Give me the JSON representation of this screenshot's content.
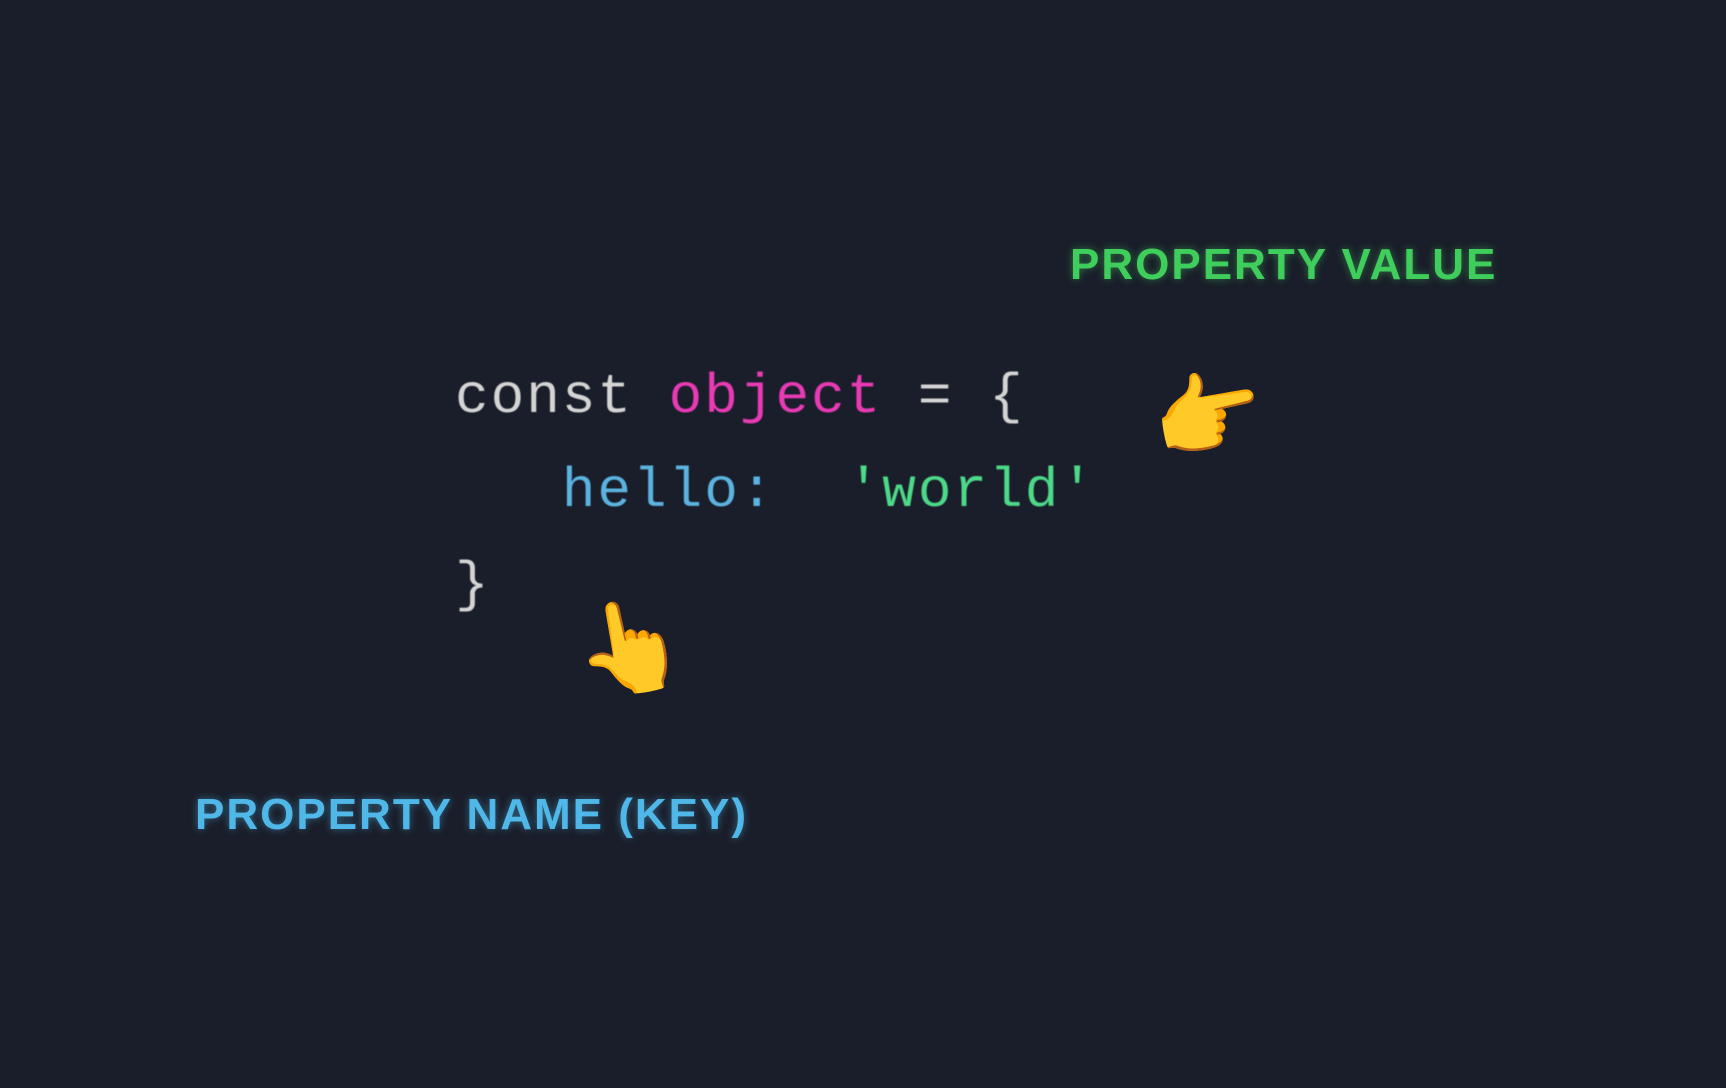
{
  "labels": {
    "property_value": "PROPERTY VALUE",
    "property_key": "PROPERTY NAME (KEY)"
  },
  "code": {
    "keyword": "const",
    "name": "object",
    "equals": "=",
    "brace_open": "{",
    "indent": "   ",
    "prop_key": "hello",
    "colon": ":",
    "string_value": "'world'",
    "brace_close": "}"
  },
  "pointers": {
    "value_icon": "👆",
    "key_icon": "👆"
  }
}
